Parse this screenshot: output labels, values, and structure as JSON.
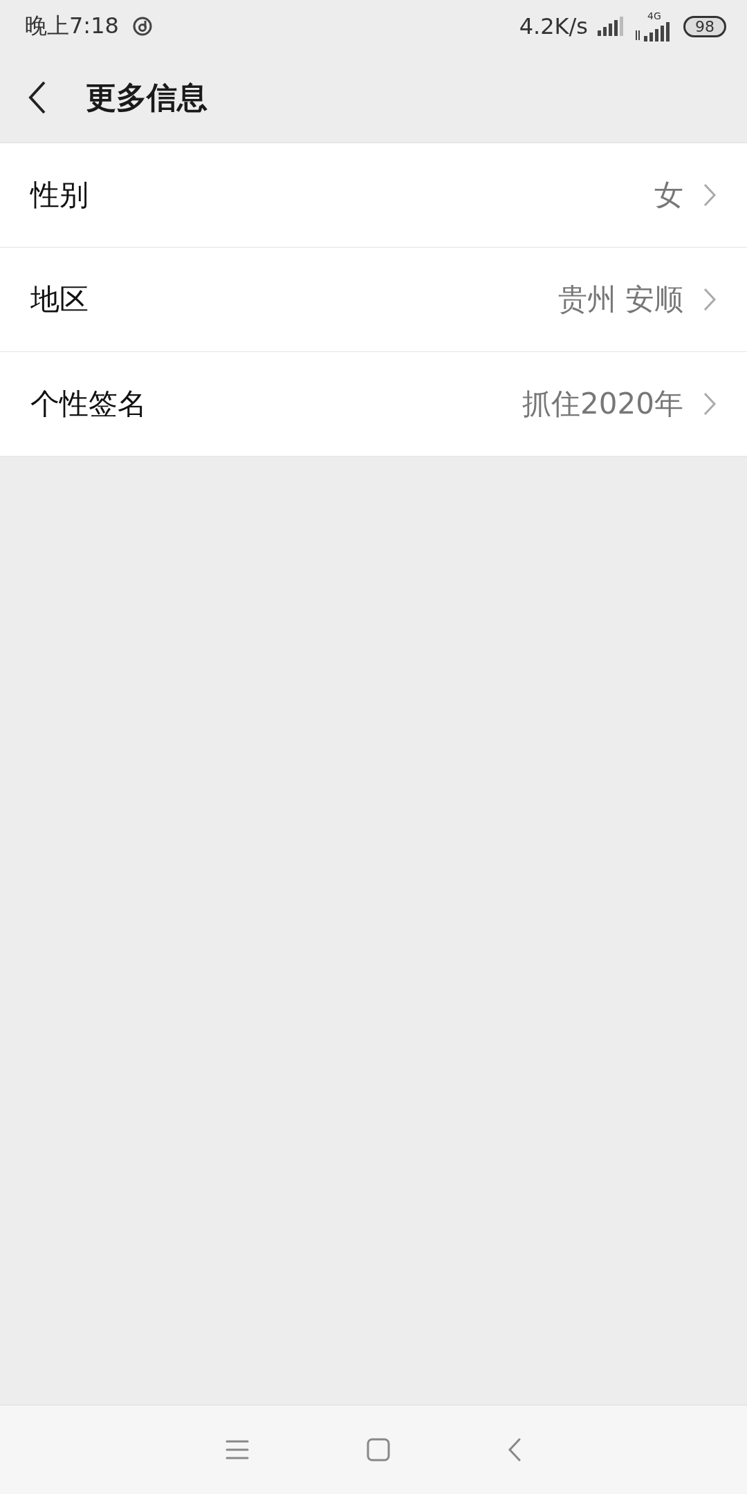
{
  "status_bar": {
    "time": "晚上7:18",
    "speed": "4.2K/s",
    "network": "4G",
    "battery": "98"
  },
  "header": {
    "title": "更多信息"
  },
  "rows": [
    {
      "label": "性别",
      "value": "女"
    },
    {
      "label": "地区",
      "value": "贵州 安顺"
    },
    {
      "label": "个性签名",
      "value": "抓住2020年"
    }
  ]
}
